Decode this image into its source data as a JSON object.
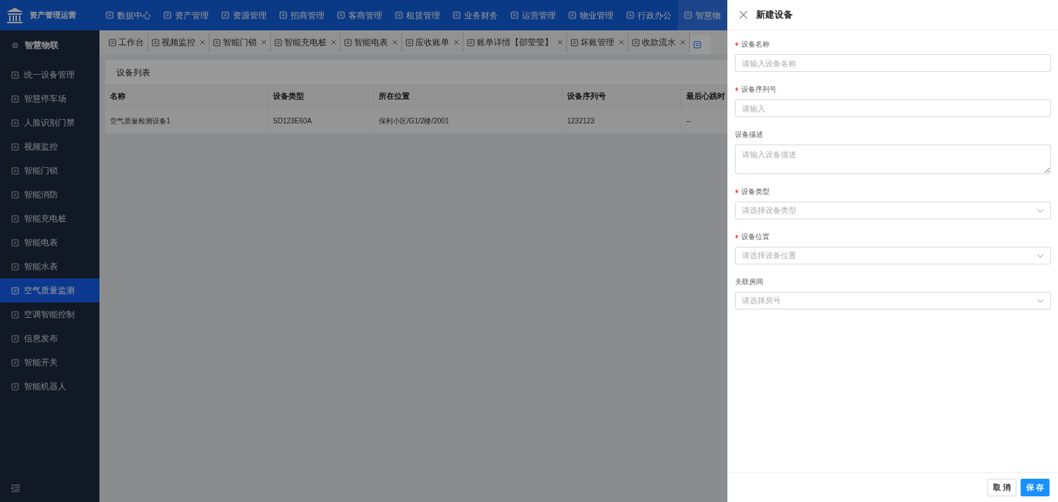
{
  "app": {
    "title": "资产管理运营"
  },
  "top_nav": [
    {
      "label": "数据中心",
      "selected": false
    },
    {
      "label": "资产管理",
      "selected": false
    },
    {
      "label": "资源管理",
      "selected": false
    },
    {
      "label": "招商管理",
      "selected": false
    },
    {
      "label": "客商管理",
      "selected": false
    },
    {
      "label": "租赁管理",
      "selected": false
    },
    {
      "label": "业务财务",
      "selected": false
    },
    {
      "label": "运营管理",
      "selected": false
    },
    {
      "label": "物业管理",
      "selected": false
    },
    {
      "label": "行政办公",
      "selected": false
    },
    {
      "label": "智慧物",
      "selected": true
    }
  ],
  "sidebar": {
    "title": "智慧物联",
    "items": [
      {
        "label": "统一设备管理",
        "selected": false
      },
      {
        "label": "智慧停车场",
        "selected": false
      },
      {
        "label": "人脸识别门禁",
        "selected": false
      },
      {
        "label": "视频监控",
        "selected": false
      },
      {
        "label": "智能门锁",
        "selected": false
      },
      {
        "label": "智能消防",
        "selected": false
      },
      {
        "label": "智能充电桩",
        "selected": false
      },
      {
        "label": "智能电表",
        "selected": false
      },
      {
        "label": "智能水表",
        "selected": false
      },
      {
        "label": "空气质量监测",
        "selected": true
      },
      {
        "label": "空调智能控制",
        "selected": false
      },
      {
        "label": "信息发布",
        "selected": false
      },
      {
        "label": "智能开关",
        "selected": false
      },
      {
        "label": "智能机器人",
        "selected": false
      }
    ]
  },
  "tabs": [
    {
      "label": "工作台",
      "closable": false,
      "selected": false
    },
    {
      "label": "视频监控",
      "closable": true,
      "selected": false
    },
    {
      "label": "智能门锁",
      "closable": true,
      "selected": false
    },
    {
      "label": "智能充电桩",
      "closable": true,
      "selected": false
    },
    {
      "label": "智能电表",
      "closable": true,
      "selected": false
    },
    {
      "label": "应收账单",
      "closable": true,
      "selected": false
    },
    {
      "label": "账单详情【邵莹莹】",
      "closable": true,
      "selected": false
    },
    {
      "label": "坏账管理",
      "closable": true,
      "selected": false
    },
    {
      "label": "收款流水",
      "closable": true,
      "selected": false
    },
    {
      "closable": false,
      "selected": true
    }
  ],
  "table": {
    "title": "设备列表",
    "columns": [
      "名称",
      "设备类型",
      "所在位置",
      "设备序列号",
      "最后心跳时"
    ],
    "rows": [
      [
        "空气质量检测设备1",
        "SD123E60A",
        "保利小区/G1/2楼/2001",
        "1232123",
        "--"
      ]
    ]
  },
  "drawer": {
    "title": "新建设备",
    "fields": [
      {
        "kind": "input",
        "label": "设备名称",
        "required": true,
        "placeholder": "请输入设备名称"
      },
      {
        "kind": "input",
        "label": "设备序列号",
        "required": true,
        "placeholder": "请输入"
      },
      {
        "kind": "textarea",
        "label": "设备描述",
        "required": false,
        "placeholder": "请输入设备描述"
      },
      {
        "kind": "select",
        "label": "设备类型",
        "required": true,
        "placeholder": "请选择设备类型"
      },
      {
        "kind": "select",
        "label": "设备位置",
        "required": true,
        "placeholder": "请选择设备位置"
      },
      {
        "kind": "select",
        "label": "关联房间",
        "required": false,
        "placeholder": "请选择房号"
      }
    ],
    "buttons": [
      {
        "kind": "default",
        "label": "取 消"
      },
      {
        "kind": "primary",
        "label": "保 存"
      }
    ]
  }
}
